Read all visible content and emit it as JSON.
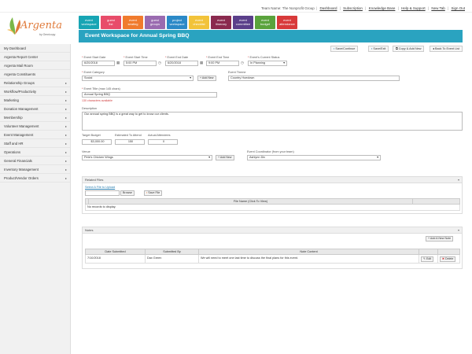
{
  "topbar": {
    "team_label": "Team Name: The Nonprofit Group",
    "team_sep": "|",
    "links": [
      "Dashboard",
      "Subscription",
      "Knowledge Base",
      "Help & Support",
      "New Tab",
      "Sign Out"
    ]
  },
  "logo": {
    "brand": "Argenta",
    "by": "by Omnicopy"
  },
  "sidebar": {
    "items": [
      {
        "label": "My Dashboard",
        "caret": ""
      },
      {
        "label": "Argenta Report Center",
        "caret": ""
      },
      {
        "label": "Argenta Mail Room",
        "caret": ""
      },
      {
        "label": "Argenta Constituents",
        "caret": ""
      },
      {
        "label": "Relationship Groups",
        "caret": "▸"
      },
      {
        "label": "Workflow/Productivity",
        "caret": "▸"
      },
      {
        "label": "Marketing",
        "caret": "▸"
      },
      {
        "label": "Donation Management",
        "caret": "▸"
      },
      {
        "label": "Membership",
        "caret": "▸"
      },
      {
        "label": "Volunteer Management",
        "caret": "▸"
      },
      {
        "label": "Event Management",
        "caret": "▸"
      },
      {
        "label": "Staff and HR",
        "caret": "▸"
      },
      {
        "label": "Operations",
        "caret": "▸"
      },
      {
        "label": "General Financials",
        "caret": "▸"
      },
      {
        "label": "Inventory Management",
        "caret": "▸"
      },
      {
        "label": "Product/Vendor Orders",
        "caret": "▸"
      }
    ]
  },
  "tabs": [
    {
      "line1": "event",
      "line2": "workspace",
      "color": "#17a5b4"
    },
    {
      "line1": "guest",
      "line2": "list",
      "color": "#e84c6a"
    },
    {
      "line1": "event",
      "line2": "seating",
      "color": "#f07b2d"
    },
    {
      "line1": "guest",
      "line2": "groups",
      "color": "#9a6bb0"
    },
    {
      "line1": "project",
      "line2": "workspace",
      "color": "#2b89c7"
    },
    {
      "line1": "event",
      "line2": "checklist",
      "color": "#f2c33a"
    },
    {
      "line1": "event",
      "line2": "itinerary",
      "color": "#8a2a4e"
    },
    {
      "line1": "event",
      "line2": "committee",
      "color": "#5a3f8a"
    },
    {
      "line1": "event",
      "line2": "budget",
      "color": "#5aa33c"
    },
    {
      "line1": "event",
      "line2": "attendance",
      "color": "#d83a3a"
    }
  ],
  "header": {
    "title": "Event Workspace for Annual Spring BBQ"
  },
  "actions": [
    "Save/Continue",
    "Save/Exit",
    "Copy & Add New",
    "Back To Event List"
  ],
  "form": {
    "start_date_label": "Event Start Date",
    "start_date": "6/20/2018",
    "start_time_label": "Event Start Time",
    "start_time": "5:00 PM",
    "end_date_label": "Event End Date",
    "end_date": "6/20/2018",
    "end_time_label": "Event End Time",
    "end_time": "9:00 PM",
    "status_label": "Event's Current Status",
    "status": "In Planning",
    "category_label": "Event Category",
    "category": "Social",
    "add_new": "Add New",
    "theme_label": "Event Theme",
    "theme": "Country Hoedown",
    "name_label": "Event Title (max 145 chars)",
    "name": "Annual Spring BBQ",
    "chars_left": "130 characters available",
    "desc_label": "Description",
    "desc": "Our annual spring BBQ is a great way to get to know our clients.",
    "budget_label": "Target Budget",
    "budget": "$3,000.00",
    "est_attend_label": "Estimated To Attend",
    "est_attend": "150",
    "actual_attend_label": "Actual Attendees",
    "actual_attend": "0",
    "vendor_label": "Venue",
    "vendor": "Pete's Chicken Wings",
    "coordinator_label": "Event Coordinator (from your team)",
    "coordinator": "Ashlynn Dix"
  },
  "files": {
    "title": "Related Files",
    "select_label": "Select A File to Upload",
    "browse": "Browse",
    "save_file": "Save File",
    "col": "File Name (Click To View)",
    "empty": "No records to display."
  },
  "notes": {
    "title": "Notes",
    "add": "Add A New Note",
    "cols": [
      "Date Submitted",
      "Submitted By",
      "Note Content"
    ],
    "rows": [
      {
        "date": "7/10/2018",
        "by": "Dax Green",
        "content": "We will need to meet one last time to discuss the final plans for this event.",
        "edit": "Edit",
        "delete": "Delete"
      }
    ]
  },
  "toggle": "▾"
}
